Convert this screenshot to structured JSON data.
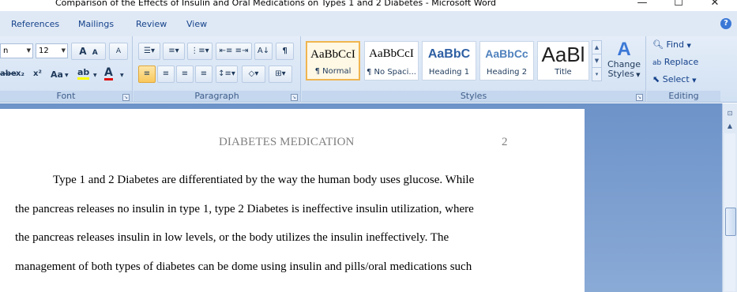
{
  "window": {
    "title": "Comparison of the Effects of Insulin and Oral Medications on Types 1 and 2 Diabetes - Microsoft Word",
    "minimize": "—",
    "maximize": "☐",
    "close": "✕"
  },
  "tabs": [
    "References",
    "Mailings",
    "Review",
    "View"
  ],
  "ribbon": {
    "font": {
      "label": "Font",
      "font_name": "n",
      "font_size": "12",
      "grow": "A",
      "shrink": "A",
      "clear": "A",
      "strike": "abe",
      "subscript": "x₂",
      "superscript": "x²",
      "change_case": "Aa",
      "highlight": "ab",
      "font_color": "A"
    },
    "paragraph": {
      "label": "Paragraph"
    },
    "styles": {
      "label": "Styles",
      "items": [
        {
          "sample": "AaBbCcI",
          "name": "¶ Normal",
          "color": "#000000"
        },
        {
          "sample": "AaBbCcI",
          "name": "¶ No Spaci...",
          "color": "#000000"
        },
        {
          "sample": "AaBbC",
          "name": "Heading 1",
          "color": "#2e5fa3"
        },
        {
          "sample": "AaBbCc",
          "name": "Heading 2",
          "color": "#4f81bd"
        },
        {
          "sample": "AaBl",
          "name": "Title",
          "color": "#1f1f1f"
        }
      ],
      "change_styles": [
        "Change",
        "Styles"
      ]
    },
    "editing": {
      "label": "Editing",
      "find": "Find",
      "replace": "Replace",
      "select": "Select"
    }
  },
  "document": {
    "header": "DIABETES MEDICATION",
    "page_number": "2",
    "lines": [
      "Type 1 and 2 Diabetes are differentiated by the way the human body uses glucose. While",
      "the pancreas releases no insulin in type 1, type 2 Diabetes is ineffective insulin utilization, where",
      "the pancreas releases insulin in low levels, or the body utilizes the insulin ineffectively. The",
      "management of both types of diabetes can be dome using insulin and pills/oral medications such"
    ]
  }
}
